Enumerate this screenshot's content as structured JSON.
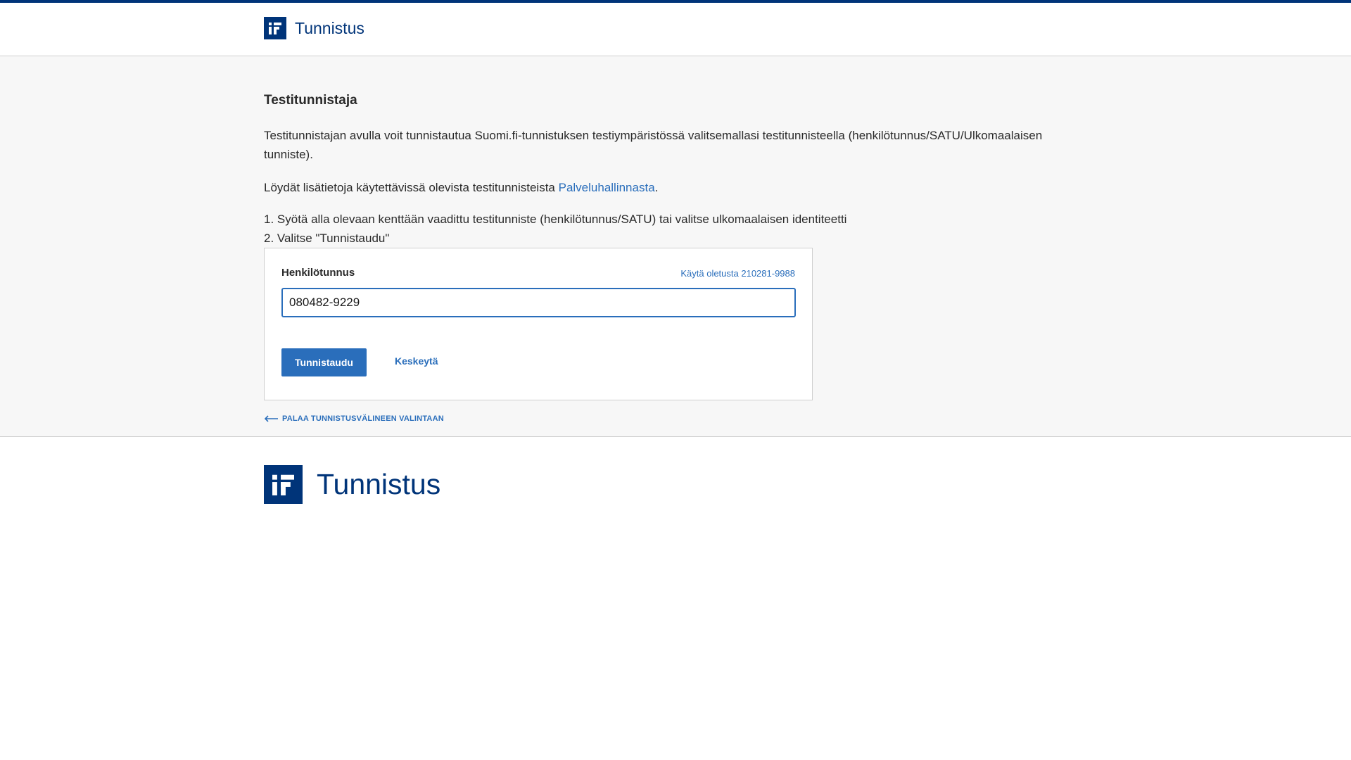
{
  "header": {
    "logo_text": "Tunnistus"
  },
  "main": {
    "title": "Testitunnistaja",
    "intro": "Testitunnistajan avulla voit tunnistautua Suomi.fi-tunnistuksen testiympäristössä valitsemallasi testitunnisteella (henkilötunnus/SATU/Ulkomaalaisen tunniste).",
    "info_prefix": "Löydät lisätietoja käytettävissä olevista testitunnisteista ",
    "info_link": "Palveluhallinnasta",
    "info_suffix": ".",
    "step1": "1. Syötä alla olevaan kenttään vaadittu testitunniste (henkilötunnus/SATU) tai valitse ulkomaalaisen identiteetti",
    "step2": "2. Valitse \"Tunnistaudu\""
  },
  "form": {
    "field_label": "Henkilötunnus",
    "default_link": "Käytä oletusta 210281-9988",
    "input_value": "080482-9229",
    "submit_label": "Tunnistaudu",
    "cancel_label": "Keskeytä"
  },
  "back_link": "PALAA TUNNISTUSVÄLINEEN VALINTAAN",
  "footer": {
    "logo_text": "Tunnistus"
  },
  "colors": {
    "brand": "#003479",
    "link": "#2a6ebb",
    "background": "#f7f7f7"
  }
}
